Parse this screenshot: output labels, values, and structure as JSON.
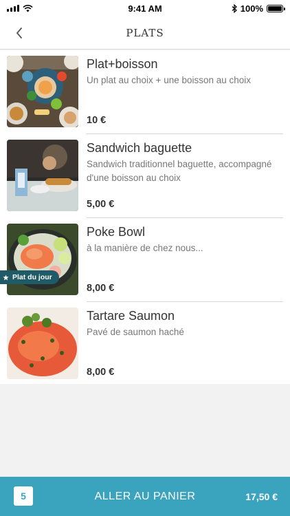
{
  "status_bar": {
    "time": "9:41 AM",
    "battery": "100%",
    "icons": [
      "signal-icon",
      "wifi-icon",
      "bluetooth-icon",
      "battery-icon"
    ]
  },
  "header": {
    "title": "PLATS",
    "back_icon": "chevron-left-icon"
  },
  "items": [
    {
      "name": "Plat+boisson",
      "description": "Un plat au choix + une boisson au choix",
      "price": "10 €"
    },
    {
      "name": "Sandwich baguette",
      "description": "Sandwich traditionnel baguette, accompagné d'une boisson au choix",
      "price": "5,00 €"
    },
    {
      "name": "Poke Bowl",
      "description": "à la manière de chez nous...",
      "price": "8,00 €",
      "badge": "Plat du jour"
    },
    {
      "name": "Tartare Saumon",
      "description": "Pavé de saumon haché",
      "price": "8,00 €"
    }
  ],
  "cart": {
    "count": "5",
    "label": "ALLER AU PANIER",
    "total": "17,50 €"
  },
  "colors": {
    "accent": "#3aa3bd",
    "badge": "#1f5b66",
    "background": "#f2f2f2"
  }
}
